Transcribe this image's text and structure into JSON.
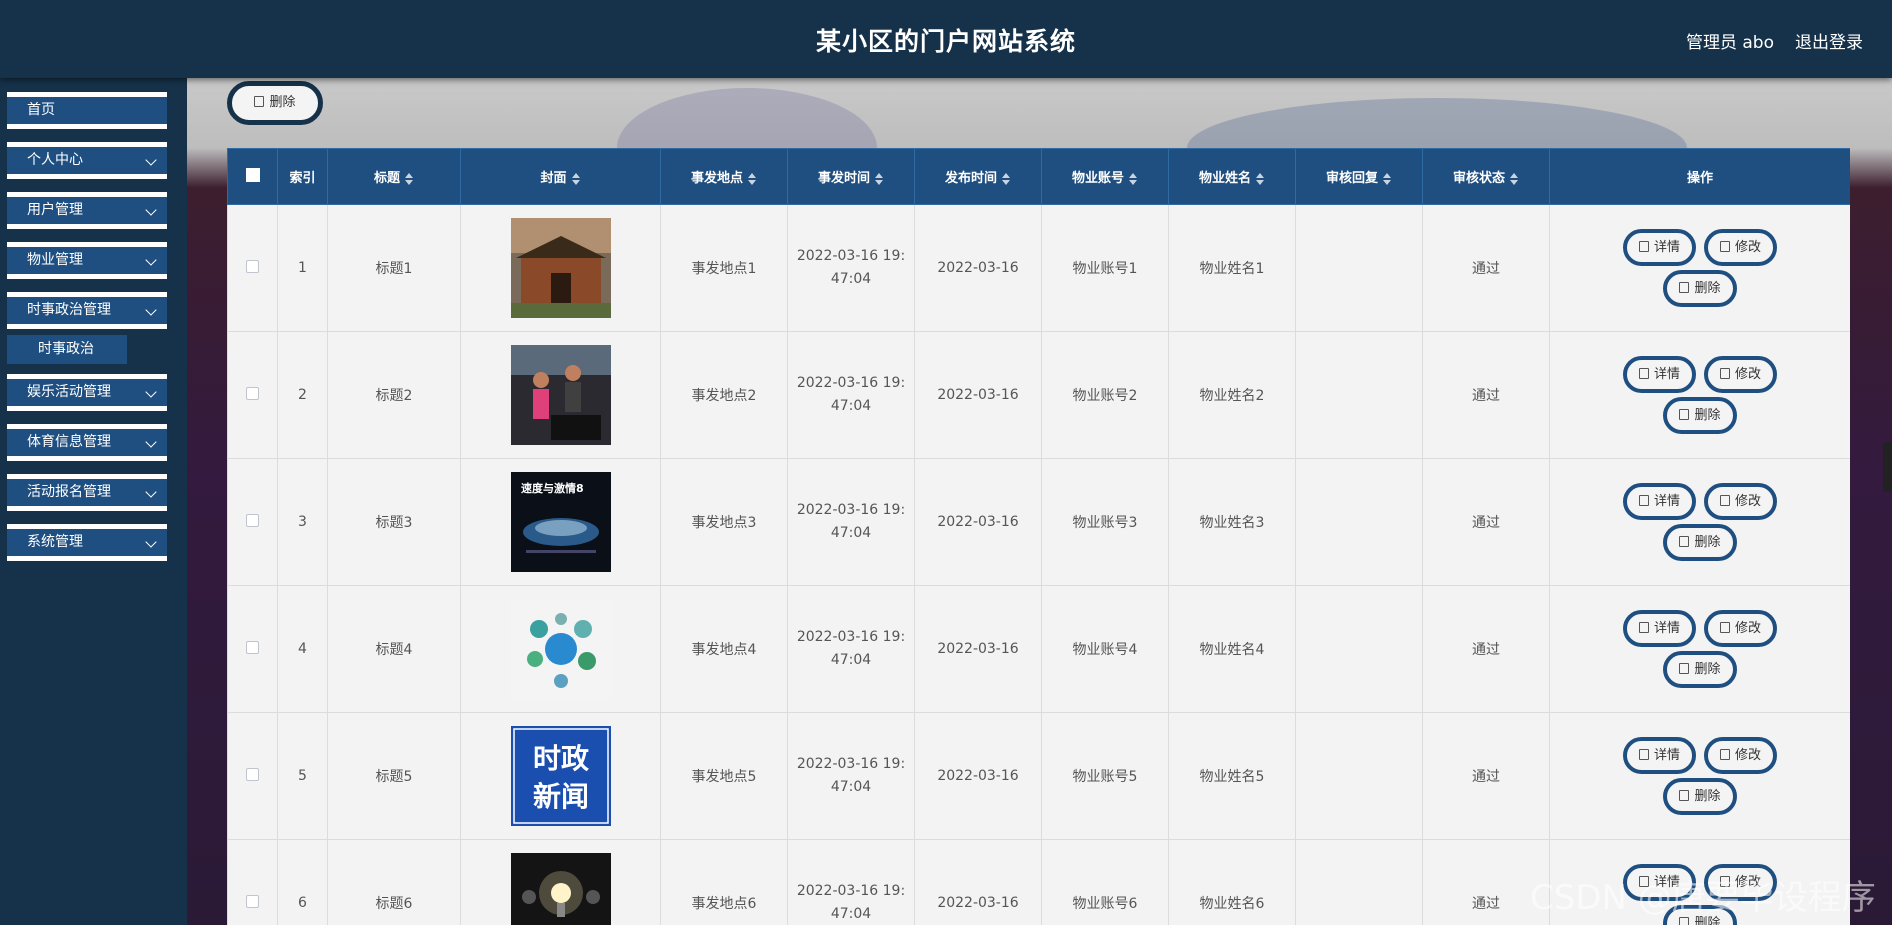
{
  "header": {
    "title": "某小区的门户网站系统",
    "user": "管理员 abo",
    "logout": "退出登录"
  },
  "sidebar": {
    "items": [
      {
        "label": "首页"
      },
      {
        "label": "个人中心"
      },
      {
        "label": "用户管理"
      },
      {
        "label": "物业管理"
      },
      {
        "label": "时事政治管理"
      },
      {
        "label": "时事政治"
      },
      {
        "label": "娱乐活动管理"
      },
      {
        "label": "体育信息管理"
      },
      {
        "label": "活动报名管理"
      },
      {
        "label": "系统管理"
      }
    ]
  },
  "toolbar": {
    "delete_label": "删除"
  },
  "table": {
    "headers": [
      "索引",
      "标题",
      "封面",
      "事发地点",
      "事发时间",
      "发布时间",
      "物业账号",
      "物业姓名",
      "审核回复",
      "审核状态",
      "操作"
    ],
    "rows": [
      {
        "index": "1",
        "title": "标题1",
        "place": "事发地点1",
        "time1": "2022-03-16 19:",
        "time2": "47:04",
        "pub": "2022-03-16",
        "acct": "物业账号1",
        "name": "物业姓名1",
        "reply": "",
        "status": "通过"
      },
      {
        "index": "2",
        "title": "标题2",
        "place": "事发地点2",
        "time1": "2022-03-16 19:",
        "time2": "47:04",
        "pub": "2022-03-16",
        "acct": "物业账号2",
        "name": "物业姓名2",
        "reply": "",
        "status": "通过"
      },
      {
        "index": "3",
        "title": "标题3",
        "place": "事发地点3",
        "time1": "2022-03-16 19:",
        "time2": "47:04",
        "pub": "2022-03-16",
        "acct": "物业账号3",
        "name": "物业姓名3",
        "reply": "",
        "status": "通过"
      },
      {
        "index": "4",
        "title": "标题4",
        "place": "事发地点4",
        "time1": "2022-03-16 19:",
        "time2": "47:04",
        "pub": "2022-03-16",
        "acct": "物业账号4",
        "name": "物业姓名4",
        "reply": "",
        "status": "通过"
      },
      {
        "index": "5",
        "title": "标题5",
        "place": "事发地点5",
        "time1": "2022-03-16 19:",
        "time2": "47:04",
        "pub": "2022-03-16",
        "acct": "物业账号5",
        "name": "物业姓名5",
        "reply": "",
        "status": "通过"
      },
      {
        "index": "6",
        "title": "标题6",
        "place": "事发地点6",
        "time1": "2022-03-16 19:",
        "time2": "47:04",
        "pub": "2022-03-16",
        "acct": "物业账号6",
        "name": "物业姓名6",
        "reply": "",
        "status": "通过"
      }
    ],
    "ops": {
      "detail": "详情",
      "edit": "修改",
      "delete": "删除"
    },
    "cover5_text": [
      "时政",
      "新闻"
    ],
    "cover3_text": "速度与激情8"
  },
  "watermark": "CSDN @唐要毕设程序"
}
